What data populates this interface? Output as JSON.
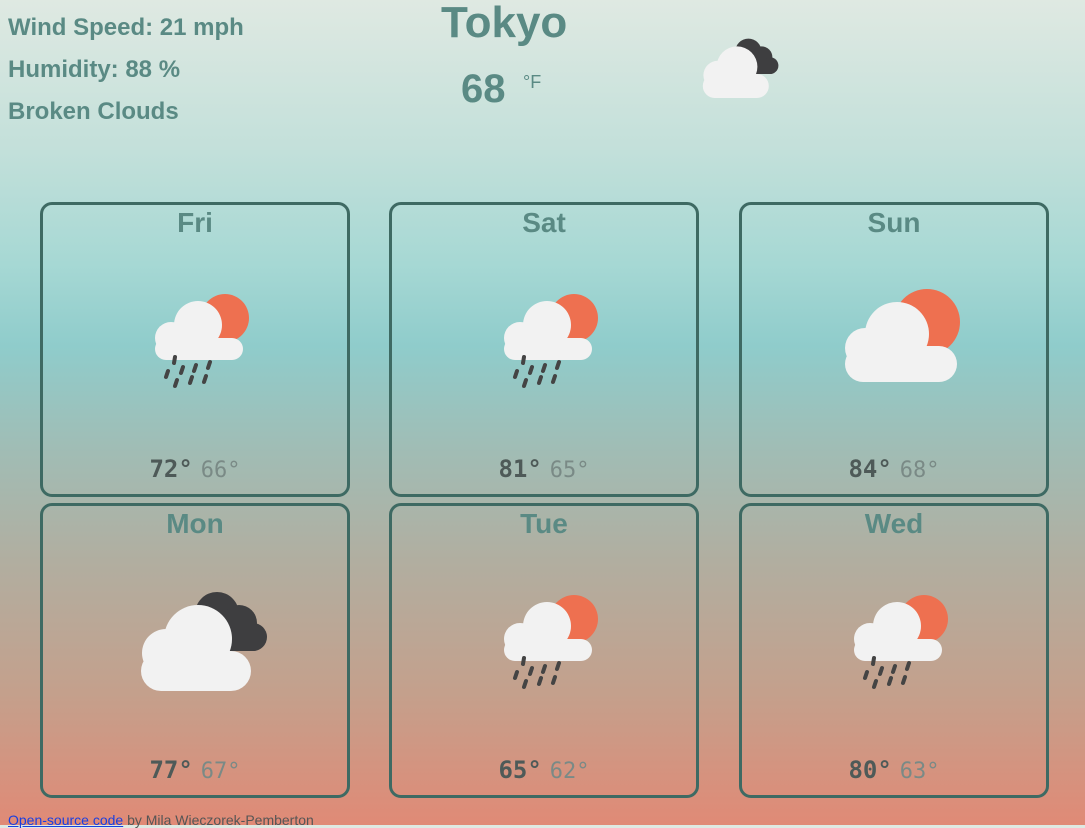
{
  "current": {
    "wind_speed": "Wind Speed: 21 mph",
    "humidity": "Humidity: 88 %",
    "description": "Broken Clouds",
    "city": "Tokyo",
    "temp": "68",
    "unit": "°F",
    "icon": "broken-clouds-icon"
  },
  "forecast": [
    {
      "day": "Fri",
      "hi": "72°",
      "lo": "66°",
      "icon": "sun-cloud-rain-icon"
    },
    {
      "day": "Sat",
      "hi": "81°",
      "lo": "65°",
      "icon": "sun-cloud-rain-icon"
    },
    {
      "day": "Sun",
      "hi": "84°",
      "lo": "68°",
      "icon": "sun-cloud-icon"
    },
    {
      "day": "Mon",
      "hi": "77°",
      "lo": "67°",
      "icon": "broken-clouds-icon"
    },
    {
      "day": "Tue",
      "hi": "65°",
      "lo": "62°",
      "icon": "sun-cloud-rain-icon"
    },
    {
      "day": "Wed",
      "hi": "80°",
      "lo": "63°",
      "icon": "sun-cloud-rain-icon"
    }
  ],
  "footer": {
    "link_text": "Open-source code",
    "credit": " by Mila Wieczorek-Pemberton"
  },
  "colors": {
    "sun": "#ee7050",
    "cloud": "#f2f2f2",
    "dark_cloud": "#3e3e40",
    "rain": "#444444",
    "card_border": "#3e6a63",
    "text": "#5a8a84"
  }
}
